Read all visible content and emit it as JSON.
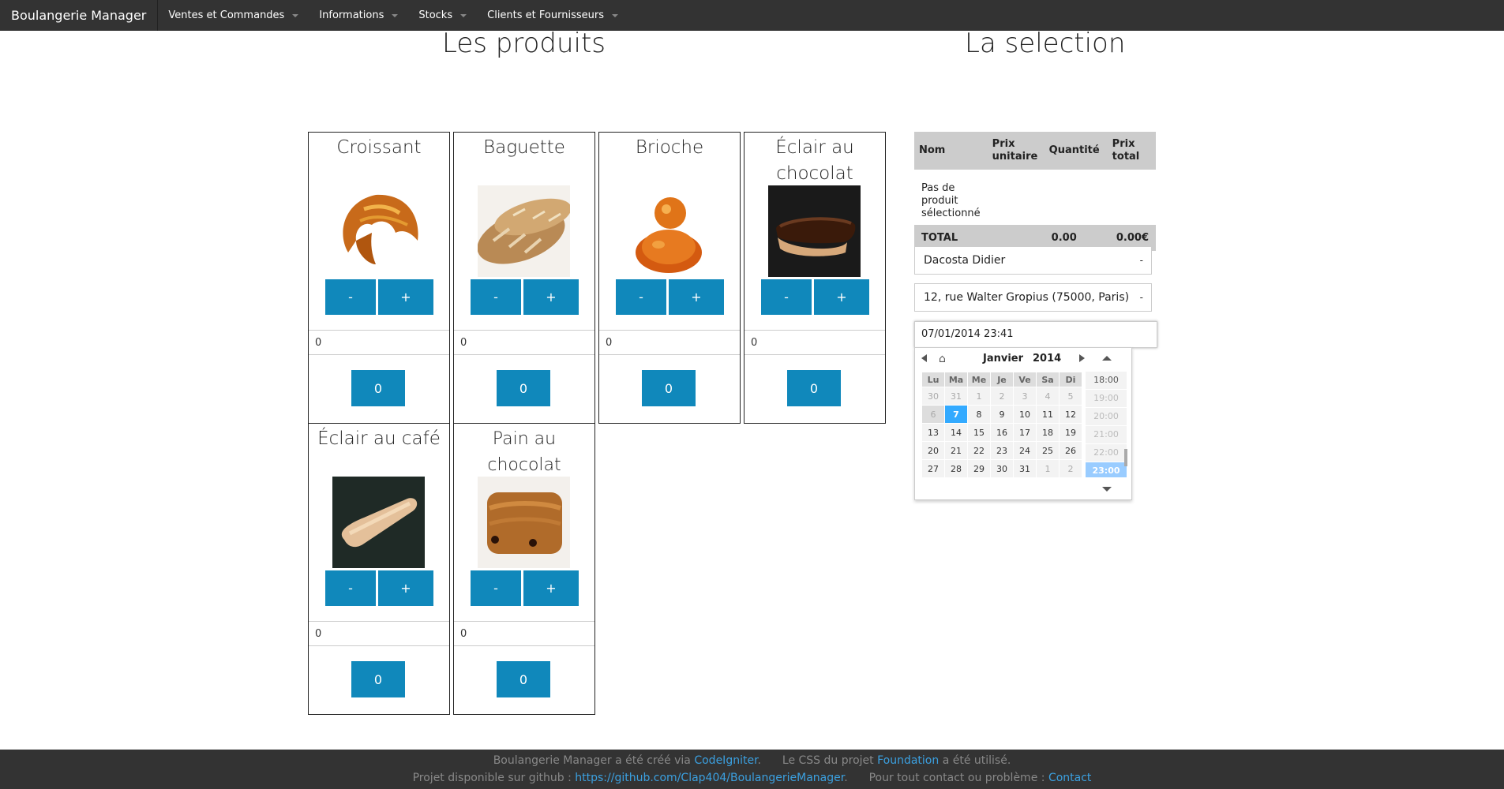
{
  "navbar": {
    "brand": "Boulangerie Manager",
    "items": [
      {
        "label": "Ventes et Commandes"
      },
      {
        "label": "Informations"
      },
      {
        "label": "Stocks"
      },
      {
        "label": "Clients et Fournisseurs"
      }
    ]
  },
  "headings": {
    "produits": "Les produits",
    "selection": "La selection"
  },
  "products": [
    {
      "name": "Croissant",
      "minus": "-",
      "plus": "+",
      "qty": "0",
      "count": "0"
    },
    {
      "name": "Baguette",
      "minus": "-",
      "plus": "+",
      "qty": "0",
      "count": "0"
    },
    {
      "name": "Brioche",
      "minus": "-",
      "plus": "+",
      "qty": "0",
      "count": "0"
    },
    {
      "name": "Éclair au chocolat",
      "minus": "-",
      "plus": "+",
      "qty": "0",
      "count": "0"
    },
    {
      "name": "Éclair au café",
      "minus": "-",
      "plus": "+",
      "qty": "0",
      "count": "0"
    },
    {
      "name": "Pain au chocolat",
      "minus": "-",
      "plus": "+",
      "qty": "0",
      "count": "0"
    }
  ],
  "selection": {
    "headers": {
      "nom": "Nom",
      "prix_unitaire": "Prix unitaire",
      "quantite": "Quantité",
      "prix_total": "Prix total"
    },
    "empty_text": "Pas de produit sélectionné",
    "total_label": "TOTAL",
    "total_qty": "0.00",
    "total_price": "0.00€",
    "client": "Dacosta Didier",
    "address": "12, rue Walter Gropius (75000, Paris)",
    "datetime": "07/01/2014 23:41"
  },
  "picker": {
    "month": "Janvier",
    "year": "2014",
    "weekdays": [
      "Lu",
      "Ma",
      "Me",
      "Je",
      "Ve",
      "Sa",
      "Di"
    ],
    "weeks": [
      [
        "30",
        "31",
        "1",
        "2",
        "3",
        "4",
        "5"
      ],
      [
        "6",
        "7",
        "8",
        "9",
        "10",
        "11",
        "12"
      ],
      [
        "13",
        "14",
        "15",
        "16",
        "17",
        "18",
        "19"
      ],
      [
        "20",
        "21",
        "22",
        "23",
        "24",
        "25",
        "26"
      ],
      [
        "27",
        "28",
        "29",
        "30",
        "31",
        "1",
        "2"
      ]
    ],
    "selected_day": "7",
    "times": [
      "18:00",
      "19:00",
      "20:00",
      "21:00",
      "22:00",
      "23:00"
    ],
    "selected_time": "23:00"
  },
  "footer": {
    "line1_a": "Boulangerie Manager a été créé via",
    "line1_link1": "CodeIgniter",
    "line1_b": ".",
    "line1_c": "Le CSS du projet",
    "line1_link2": "Foundation",
    "line1_d": "a été utilisé.",
    "line2_a": "Projet disponible sur github :",
    "line2_link1": "https://github.com/Clap404/BoulangerieManager",
    "line2_b": ".",
    "line2_c": "Pour tout contact ou problème :",
    "line2_link2": "Contact"
  }
}
